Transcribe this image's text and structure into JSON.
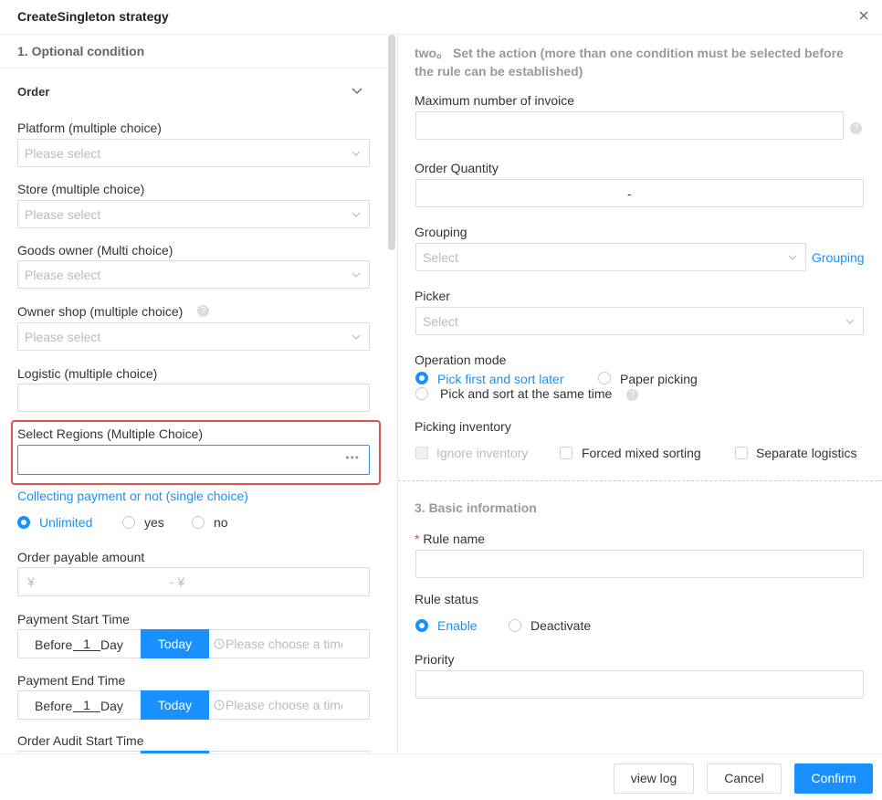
{
  "dialog": {
    "title": "CreateSingleton strategy"
  },
  "left": {
    "section_title": "1. Optional condition",
    "order_label": "Order",
    "platform": {
      "label": "Platform (multiple choice)",
      "placeholder": "Please select"
    },
    "store": {
      "label": "Store (multiple choice)",
      "placeholder": "Please select"
    },
    "goods_owner": {
      "label": "Goods owner (Multi choice)",
      "placeholder": "Please select"
    },
    "owner_shop": {
      "label": "Owner shop (multiple choice)",
      "placeholder": "Please select"
    },
    "logistic": {
      "label": "Logistic (multiple choice)"
    },
    "regions": {
      "label": "Select Regions (Multiple Choice)",
      "ellipsis": "•••"
    },
    "collecting": {
      "label": "Collecting payment or not (single choice)",
      "options": [
        "Unlimited",
        "yes",
        "no"
      ]
    },
    "payable": {
      "label": "Order payable amount",
      "currency": "¥",
      "separator": "- ¥"
    },
    "payment_start": {
      "label": "Payment Start Time",
      "before": "Before",
      "day_value": "1",
      "day": "Day",
      "today": "Today",
      "placeholder": "Please choose a time"
    },
    "payment_end": {
      "label": "Payment End Time",
      "before": "Before",
      "day_value": "1",
      "day": "Day",
      "today": "Today",
      "placeholder": "Please choose a time"
    },
    "audit_start": {
      "label": "Order Audit Start Time"
    }
  },
  "right": {
    "section2_title_line1": "two。 Set the action (more than one condition must be selected before",
    "section2_title_line2": "the rule can be established)",
    "max_invoice": {
      "label": "Maximum number of invoice"
    },
    "order_qty": {
      "label": "Order Quantity",
      "separator": "-"
    },
    "grouping": {
      "label": "Grouping",
      "placeholder": "Select",
      "link": "Grouping"
    },
    "picker": {
      "label": "Picker",
      "placeholder": "Select"
    },
    "operation_mode": {
      "label": "Operation mode",
      "options": [
        "Pick first and sort later",
        "Paper picking",
        "Pick and sort at the same time"
      ]
    },
    "picking_inventory": {
      "label": "Picking inventory",
      "options": [
        "Ignore inventory",
        "Forced mixed sorting",
        "Separate logistics"
      ]
    },
    "section3_title": "3. Basic information",
    "rule_name": {
      "required": "*",
      "label": "Rule name"
    },
    "rule_status": {
      "label": "Rule status",
      "options": [
        "Enable",
        "Deactivate"
      ]
    },
    "priority": {
      "label": "Priority"
    }
  },
  "footer": {
    "view_log": "view log",
    "cancel": "Cancel",
    "confirm": "Confirm"
  },
  "colors": {
    "accent": "#1890ff",
    "highlight": "#d9534f"
  },
  "icons": [
    "close-icon",
    "chevron-down-icon",
    "help-icon",
    "clock-icon"
  ]
}
